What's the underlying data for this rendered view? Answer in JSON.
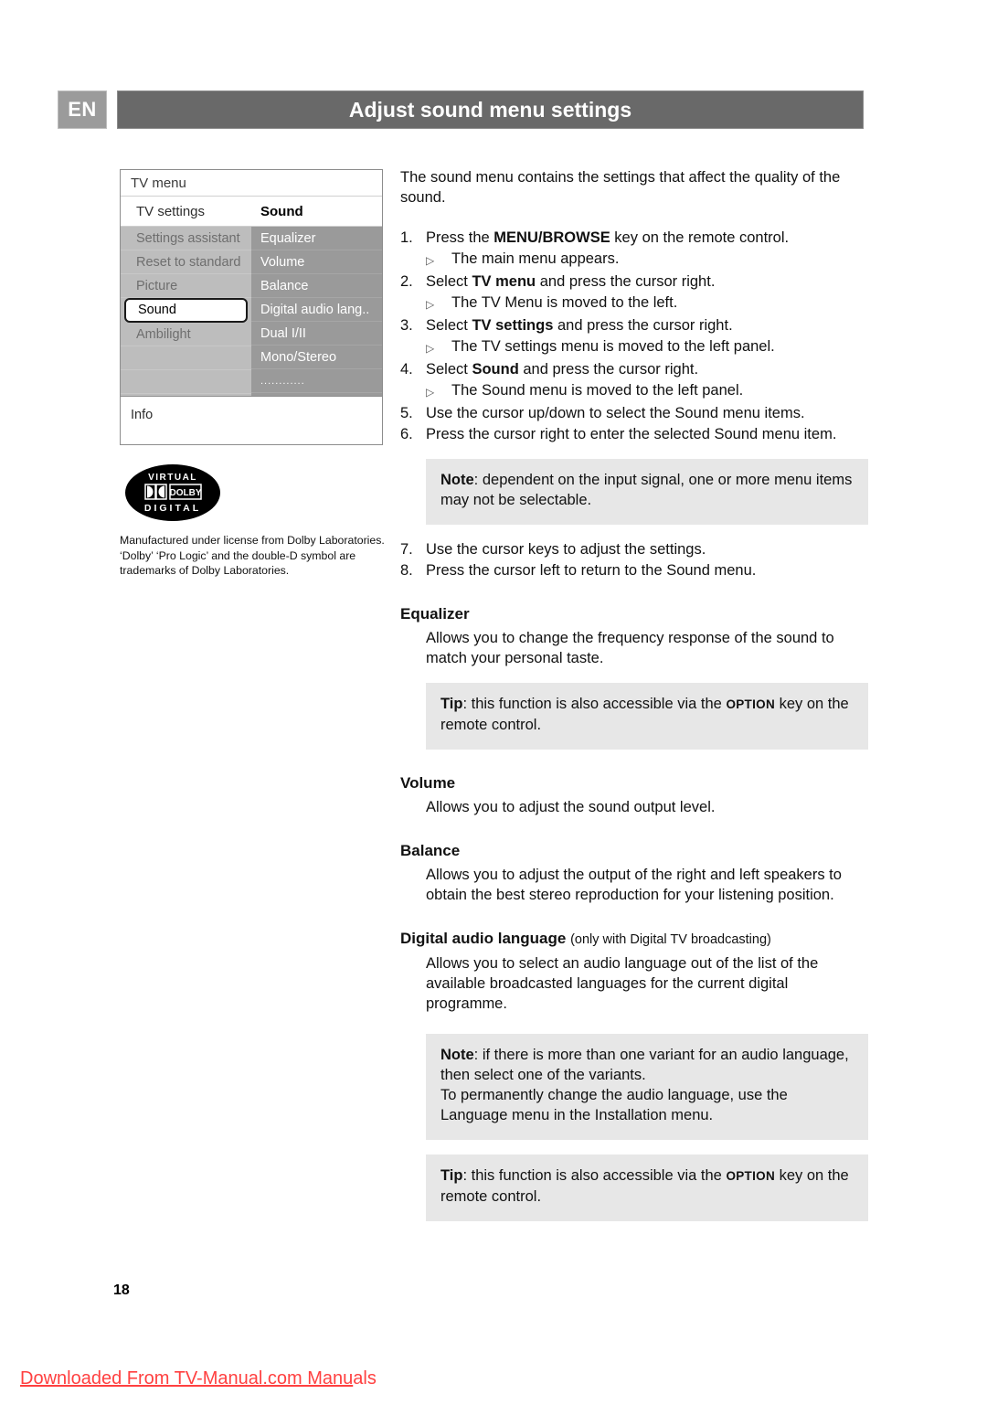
{
  "header": {
    "language_badge": "EN",
    "title": "Adjust sound menu settings"
  },
  "tv_menu": {
    "title": "TV menu",
    "breadcrumb_left": "TV settings",
    "breadcrumb_right": "Sound",
    "left_items": [
      "Settings assistant",
      "Reset to standard",
      "Picture",
      "Sound",
      "Ambilight"
    ],
    "selected_left_item": "Sound",
    "right_items": [
      "Equalizer",
      "Volume",
      "Balance",
      "Digital audio lang..",
      "Dual I/II",
      "Mono/Stereo",
      "............"
    ],
    "info_label": "Info"
  },
  "dolby": {
    "logo_top": "VIRTUAL",
    "logo_mid": "DOLBY",
    "logo_bottom": "DIGITAL",
    "notice": "Manufactured under license from Dolby Laboratories. ‘Dolby’ ‘Pro Logic’ and the double-D symbol are trademarks of Dolby Laboratories."
  },
  "content": {
    "intro": "The sound menu contains the settings that affect the quality of the sound.",
    "steps": [
      {
        "num": "1.",
        "pre": "Press the ",
        "bold": "MENU/BROWSE",
        "post": " key on the remote control."
      },
      {
        "num": "2.",
        "pre": "Select ",
        "bold": "TV menu",
        "post": " and press the cursor right."
      },
      {
        "num": "3.",
        "pre": "Select ",
        "bold": "TV settings",
        "post": " and press the cursor right."
      },
      {
        "num": "4.",
        "pre": "Select ",
        "bold": "Sound",
        "post": " and press the cursor right."
      },
      {
        "num": "5.",
        "pre": "Use the cursor up/down to select the Sound menu items.",
        "bold": "",
        "post": ""
      },
      {
        "num": "6.",
        "pre": "Press the cursor right to enter the selected Sound menu item.",
        "bold": "",
        "post": ""
      },
      {
        "num": "7.",
        "pre": "Use the cursor keys to adjust the settings.",
        "bold": "",
        "post": ""
      },
      {
        "num": "8.",
        "pre": "Press the cursor left to return to the Sound menu.",
        "bold": "",
        "post": ""
      }
    ],
    "sub_results": {
      "s1": "The main menu appears.",
      "s2": "The TV Menu is moved to the left.",
      "s3": "The TV settings menu is moved to the left panel.",
      "s4": "The Sound menu is moved to the left panel."
    },
    "note_1": {
      "label": "Note",
      "text": ": dependent on the input signal, one or more menu items may not be selectable."
    },
    "sections": {
      "equalizer": {
        "heading": "Equalizer",
        "body": "Allows you to change the frequency response of the sound to match your personal taste."
      },
      "volume": {
        "heading": "Volume",
        "body": "Allows you to adjust the sound output level."
      },
      "balance": {
        "heading": "Balance",
        "body": "Allows you to adjust the output of the right and left speakers to obtain the best stereo reproduction for your listening position."
      },
      "digital_audio_language": {
        "heading": "Digital audio language",
        "heading_suffix": "(only with Digital TV broadcasting)",
        "body": "Allows you to select an audio language out of the list of the available broadcasted languages for the current digital programme."
      }
    },
    "tip_1": {
      "label": "Tip",
      "pre": ": this function is also accessible via the ",
      "key": "OPTION",
      "post": " key on the remote control."
    },
    "note_2": {
      "label": "Note",
      "text": ": if there is more than one variant for an audio language, then select one of the variants.",
      "line2": "To permanently change the audio language, use the Language menu in the Installation menu."
    },
    "tip_2": {
      "label": "Tip",
      "pre": ": this function is also accessible via the ",
      "key": "OPTION",
      "post": " key on the remote control."
    }
  },
  "footer": {
    "page_number": "18",
    "download_text_underlined": "Downloaded From TV-Manual.com Manu",
    "download_text_plain": "als"
  },
  "colors": {
    "header_bar": "#696969",
    "badge": "#9b9b9b",
    "menu_left_panel": "#bdbdbd",
    "menu_right_panel": "#9a9a9a",
    "callout_bg": "#e7e7e7",
    "footer_red": "#ff4040"
  }
}
